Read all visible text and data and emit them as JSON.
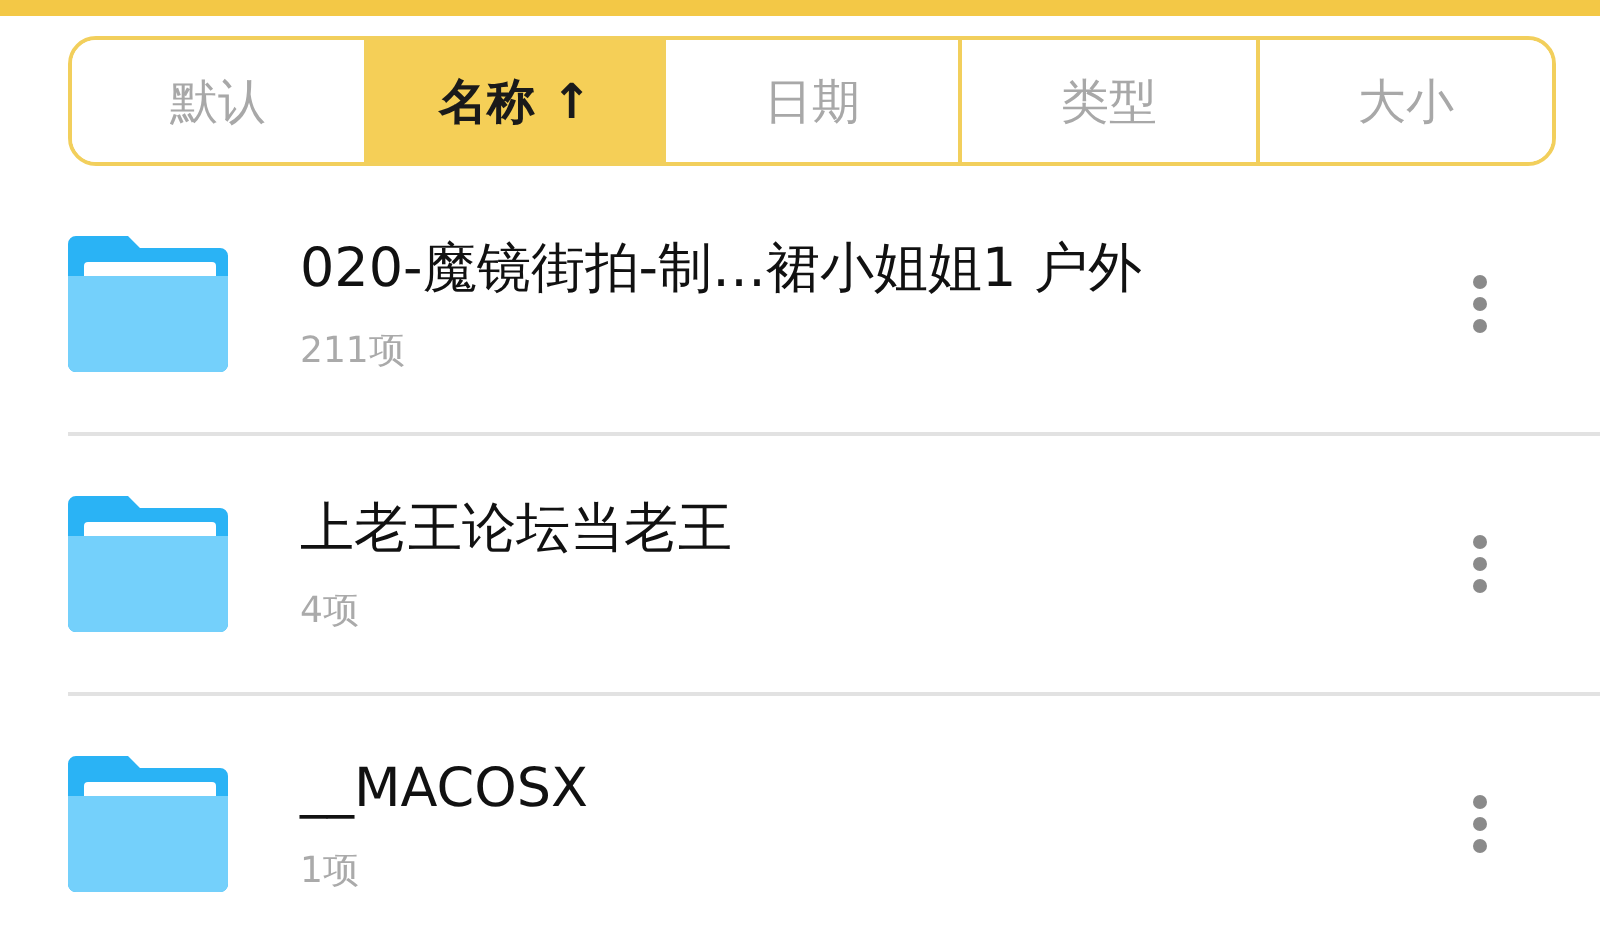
{
  "sort_tabs": [
    {
      "label": "默认",
      "selected": false
    },
    {
      "label": "名称 ↑",
      "selected": true
    },
    {
      "label": "日期",
      "selected": false
    },
    {
      "label": "类型",
      "selected": false
    },
    {
      "label": "大小",
      "selected": false
    }
  ],
  "files": [
    {
      "name": "020-魔镜街拍-制…裙小姐姐1 户外",
      "count": "211项"
    },
    {
      "name": "上老王论坛当老王",
      "count": "4项"
    },
    {
      "name": "__MACOSX",
      "count": "1项"
    }
  ]
}
